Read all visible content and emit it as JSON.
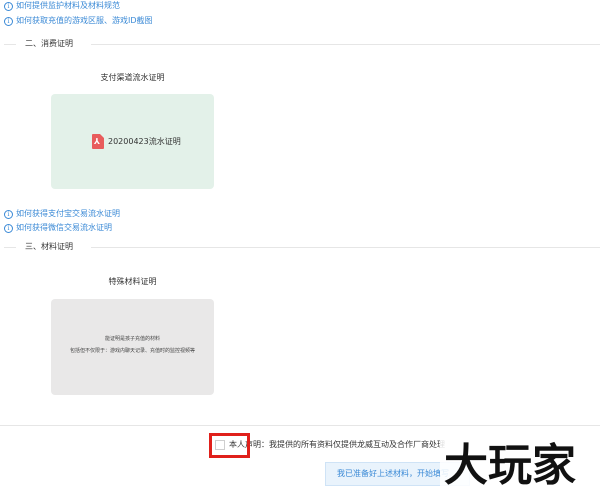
{
  "top_links": [
    "如何提供监护材料及材料规范",
    "如何获取充值的游戏区服、游戏ID截图"
  ],
  "section2": {
    "title": "二、消费证明",
    "card_title": "支付渠道流水证明",
    "file_name": "20200423流水证明",
    "file_icon": "pdf-icon",
    "links": [
      "如何获得支付宝交易流水证明",
      "如何获得微信交易流水证明"
    ]
  },
  "section3": {
    "title": "三、材料证明",
    "card_title": "特殊材料证明",
    "desc_line1": "能证明是孩子充值的材料",
    "desc_line2": "包括但不仅限于：游戏内聊天记录、充值时的监控视频等"
  },
  "declaration": {
    "text": "本人声明：我提供的所有资料仅提供龙威互动及合作厂商处理"
  },
  "submit_button": "我已准备好上述材料，开始填写",
  "watermark": "大玩家",
  "colors": {
    "link": "#3b8ad6",
    "highlight_box": "#e0201b",
    "green_card": "#e3f1e9",
    "gray_card": "#e9e8e8"
  }
}
